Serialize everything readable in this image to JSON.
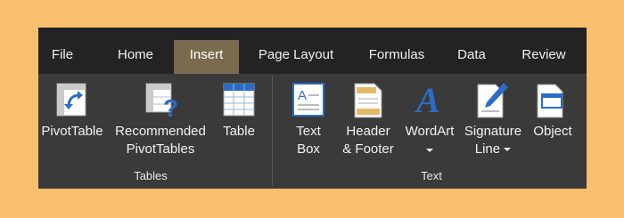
{
  "tabs": [
    "File",
    "Home",
    "Insert",
    "Page Layout",
    "Formulas",
    "Data",
    "Review"
  ],
  "active_tab": "Insert",
  "groups": {
    "tables": {
      "label": "Tables",
      "pivottable": "PivotTable",
      "recommended_line1": "Recommended",
      "recommended_line2": "PivotTables",
      "table": "Table"
    },
    "text": {
      "label": "Text",
      "textbox_line1": "Text",
      "textbox_line2": "Box",
      "header_line1": "Header",
      "header_line2": "& Footer",
      "wordart": "WordArt",
      "signature_line1": "Signature",
      "signature_line2": "Line",
      "object": "Object"
    }
  },
  "colors": {
    "background": "#f7bf6e",
    "tab_bar": "#232323",
    "ribbon": "#3a3a3a",
    "active_tab": "#7a6a4e",
    "icon_blue": "#2b6cc4"
  }
}
